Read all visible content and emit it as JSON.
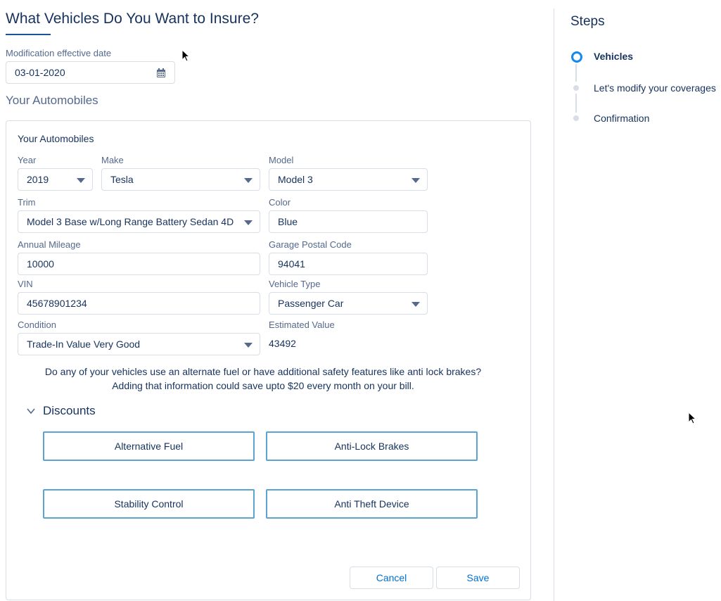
{
  "page": {
    "title": "What Vehicles Do You Want to Insure?",
    "effective_date_label": "Modification effective date",
    "effective_date_value": "03-01-2020",
    "section_title": "Your Automobiles"
  },
  "card": {
    "title": "Your Automobiles",
    "fields": {
      "year": {
        "label": "Year",
        "value": "2019"
      },
      "make": {
        "label": "Make",
        "value": "Tesla"
      },
      "model": {
        "label": "Model",
        "value": "Model 3"
      },
      "trim": {
        "label": "Trim",
        "value": "Model 3 Base w/Long Range Battery Sedan 4D"
      },
      "color": {
        "label": "Color",
        "value": "Blue"
      },
      "mileage": {
        "label": "Annual Mileage",
        "value": "10000"
      },
      "postal": {
        "label": "Garage Postal Code",
        "value": "94041"
      },
      "vin": {
        "label": "VIN",
        "value": "45678901234"
      },
      "vehicle_type": {
        "label": "Vehicle Type",
        "value": "Passenger Car"
      },
      "condition": {
        "label": "Condition",
        "value": "Trade-In Value Very Good"
      },
      "estimated_value": {
        "label": "Estimated Value",
        "value": "43492"
      }
    },
    "info_line1": "Do any of your vehicles use an alternate fuel or have additional safety features like anti lock brakes?",
    "info_line2": "Adding that information could save upto $20 every month on your bill.",
    "discounts": {
      "title": "Discounts",
      "items": [
        "Alternative Fuel",
        "Anti-Lock Brakes",
        "Stability Control",
        "Anti Theft Device"
      ]
    },
    "cancel_label": "Cancel",
    "save_label": "Save"
  },
  "steps": {
    "title": "Steps",
    "items": [
      "Vehicles",
      "Let's modify your coverages",
      "Confirmation"
    ]
  },
  "colors": {
    "accent": "#1589ee",
    "text": "#16325c",
    "label": "#54698d",
    "discount_border": "#5ba3d0"
  },
  "icons": [
    "calendar-icon",
    "chevron-down-icon",
    "caret-down-icon",
    "cursor-icon"
  ]
}
